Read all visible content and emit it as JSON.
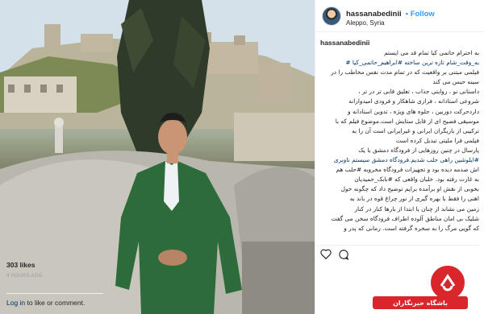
{
  "post": {
    "username": "hassanabedinii",
    "follow_label": "• Follow",
    "location": "Aleppo, Syria",
    "caption_user": "hassanabedinii",
    "caption_lines": [
      {
        "text": "به احترام حاتمی کیا تمام قد می ایستم"
      },
      {
        "text": "به_وقت_شام تازه ترین ساخته #ابراهیم_حاتمی_کیا #",
        "tag": true
      },
      {
        "text": "فیلمی مبتنی بر واقعیت که در تمام مدت نفس مخاطب را در"
      },
      {
        "text": "سینه حبس می کند"
      },
      {
        "text": "داستانی نو ، روایتی جذاب ، تعلیق قابی تر در تر ،"
      },
      {
        "text": "شروعی استادانه ، فرازی شاهکار و فرودی امیدوارانه"
      },
      {
        "text": "داردحرکت دوربین ، جلوه های ویژه ، تدوین استادانه و"
      },
      {
        "text": "موسیقی فصیح ای از قابل ستایش است.موضوع فیلم که با"
      },
      {
        "text": "ترکیبی از بازیگران ایرانی و غیرایرانی است آن را به"
      },
      {
        "text": "فیلمی فرا ملیتی تبدیل کرده است"
      },
      {
        "text": "پارسال در چنین روزهایی از فرودگاه دمشق با یک"
      },
      {
        "text": "#ایلوشین راهی حلب شدیم.فرودگاه دمشق سیستم ناوبری",
        "tag": true
      },
      {
        "text": "اش صدمه دیده بود و تجهیزات فرودگاه مخروبه #حلب هم"
      },
      {
        "text": "به غارت رفته بود. خلبان واقعی که #بابک_حمیدیان"
      },
      {
        "text": "بخوبی از نقش او برآمده برایم توضیح داد که چگونه خول"
      },
      {
        "text": "اهنی را فقط با بهره گیری از نور چراغ قوه در باند به"
      },
      {
        "text": "زمین می نشاند از چنان یا ابتدا از بارها کنار در کنار"
      },
      {
        "text": "شلیک بی امان مناطق آلوده اطراف فرودگاه سخن می گفت"
      },
      {
        "text": "که گویی مرگ را به سخره گرفته است. رمانی که پدر و"
      }
    ],
    "likes": "303 likes",
    "time_ago": "4 HOURS AGO",
    "login_text": "Log in",
    "login_suffix": "to like or comment."
  },
  "watermark": {
    "text": "باشگاه خبرنگاران"
  },
  "colors": {
    "accent": "#3897f0",
    "watermark_red": "#d8262c"
  },
  "icons": [
    "heart-icon",
    "comment-icon",
    "watermark-logo-icon"
  ]
}
